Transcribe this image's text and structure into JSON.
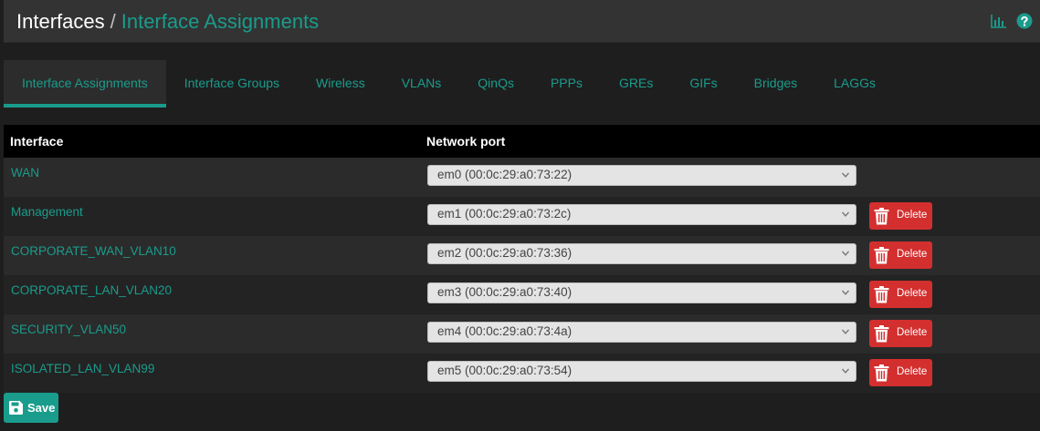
{
  "breadcrumb": {
    "root": "Interfaces",
    "separator": "/",
    "current": "Interface Assignments"
  },
  "header_icons": [
    "bar-chart-icon",
    "help-icon"
  ],
  "tabs": [
    {
      "label": "Interface Assignments",
      "active": true
    },
    {
      "label": "Interface Groups",
      "active": false
    },
    {
      "label": "Wireless",
      "active": false
    },
    {
      "label": "VLANs",
      "active": false
    },
    {
      "label": "QinQs",
      "active": false
    },
    {
      "label": "PPPs",
      "active": false
    },
    {
      "label": "GREs",
      "active": false
    },
    {
      "label": "GIFs",
      "active": false
    },
    {
      "label": "Bridges",
      "active": false
    },
    {
      "label": "LAGGs",
      "active": false
    }
  ],
  "table": {
    "headers": {
      "interface": "Interface",
      "network_port": "Network port"
    },
    "rows": [
      {
        "interface": "WAN",
        "port": "em0 (00:0c:29:a0:73:22)",
        "deletable": false
      },
      {
        "interface": "Management",
        "port": "em1 (00:0c:29:a0:73:2c)",
        "deletable": true
      },
      {
        "interface": "CORPORATE_WAN_VLAN10",
        "port": "em2 (00:0c:29:a0:73:36)",
        "deletable": true
      },
      {
        "interface": "CORPORATE_LAN_VLAN20",
        "port": "em3 (00:0c:29:a0:73:40)",
        "deletable": true
      },
      {
        "interface": "SECURITY_VLAN50",
        "port": "em4 (00:0c:29:a0:73:4a)",
        "deletable": true
      },
      {
        "interface": "ISOLATED_LAN_VLAN99",
        "port": "em5 (00:0c:29:a0:73:54)",
        "deletable": true
      }
    ],
    "delete_label": "Delete"
  },
  "save_label": "Save",
  "colors": {
    "accent": "#1a9c8c",
    "delete": "#d32f2f",
    "background": "#1e1e1e",
    "header": "#333333"
  }
}
